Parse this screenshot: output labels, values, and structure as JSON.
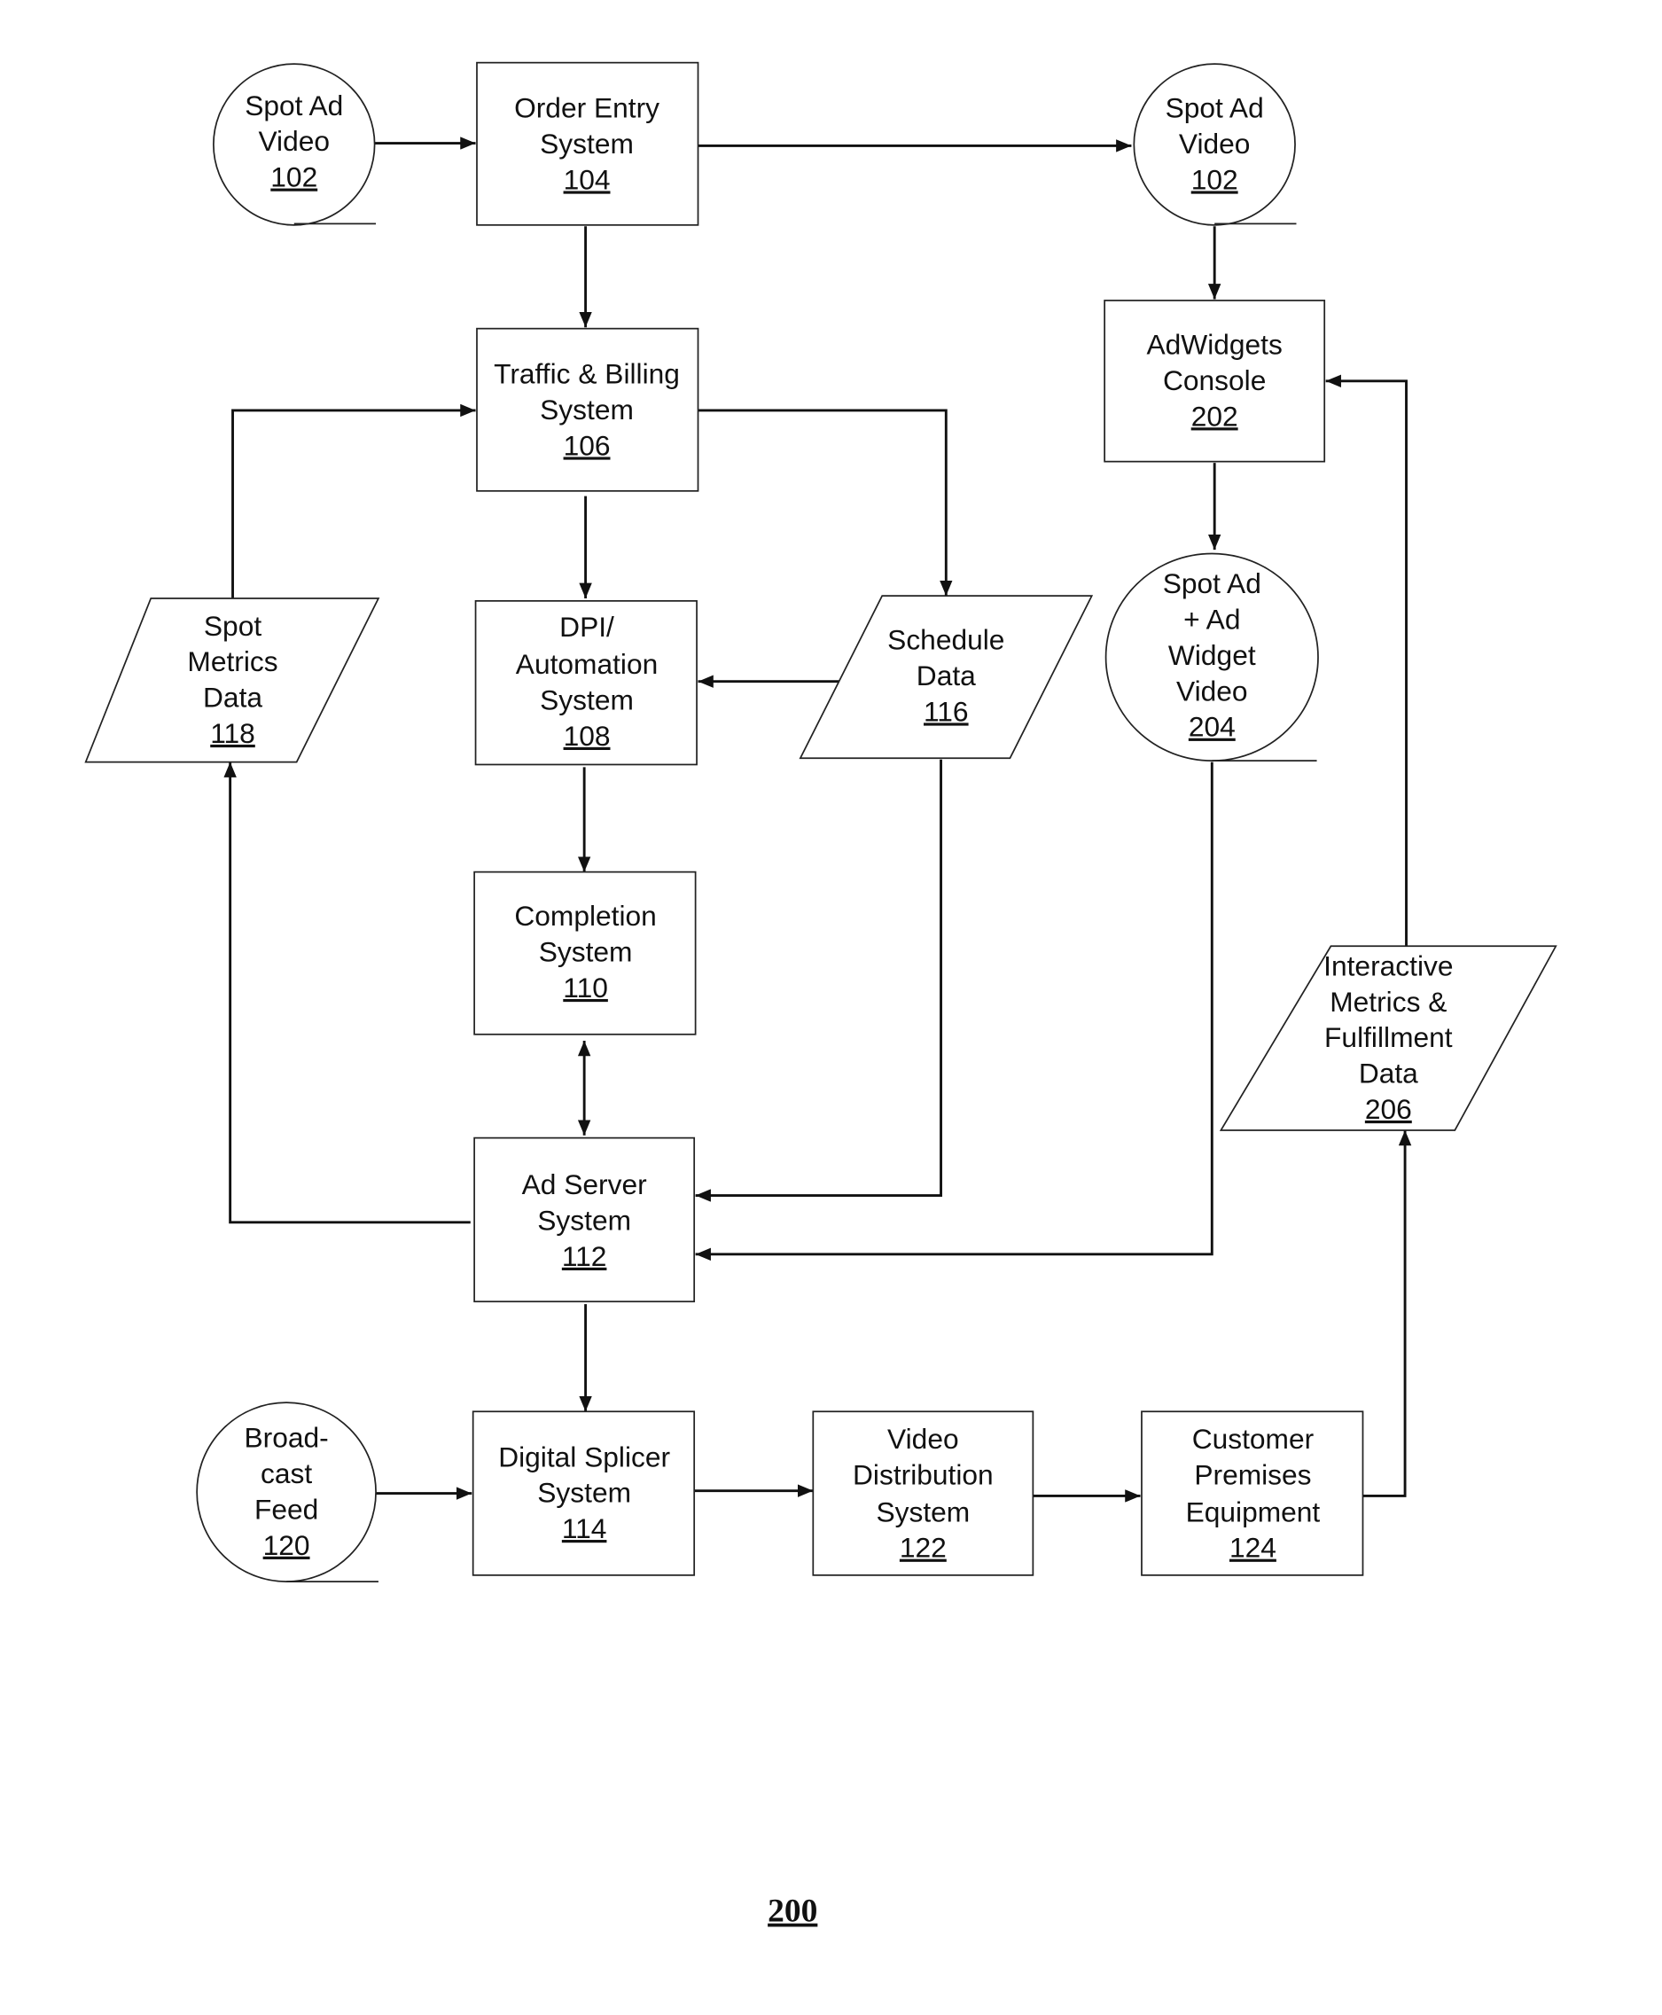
{
  "figure_number": "200",
  "nodes": {
    "spot_ad_video_in": {
      "lines": [
        "Spot Ad",
        "Video"
      ],
      "ref": "102",
      "shape": "circle"
    },
    "order_entry": {
      "lines": [
        "Order Entry",
        "System"
      ],
      "ref": "104",
      "shape": "box"
    },
    "spot_ad_video_out": {
      "lines": [
        "Spot Ad",
        "Video"
      ],
      "ref": "102",
      "shape": "circle"
    },
    "traffic_billing": {
      "lines": [
        "Traffic & Billing",
        "System"
      ],
      "ref": "106",
      "shape": "box"
    },
    "adwidgets_console": {
      "lines": [
        "AdWidgets",
        "Console"
      ],
      "ref": "202",
      "shape": "box"
    },
    "spot_metrics": {
      "lines": [
        "Spot",
        "Metrics",
        "Data"
      ],
      "ref": "118",
      "shape": "parallelogram"
    },
    "dpi_automation": {
      "lines": [
        "DPI/",
        "Automation",
        "System"
      ],
      "ref": "108",
      "shape": "box"
    },
    "schedule_data": {
      "lines": [
        "Schedule",
        "Data"
      ],
      "ref": "116",
      "shape": "parallelogram"
    },
    "spot_ad_widget_video": {
      "lines": [
        "Spot Ad",
        "+ Ad",
        "Widget",
        "Video"
      ],
      "ref": "204",
      "shape": "circle"
    },
    "completion": {
      "lines": [
        "Completion",
        "System"
      ],
      "ref": "110",
      "shape": "box"
    },
    "interactive_metrics": {
      "lines": [
        "Interactive",
        "Metrics &",
        "Fulfillment",
        "Data"
      ],
      "ref": "206",
      "shape": "parallelogram"
    },
    "ad_server": {
      "lines": [
        "Ad Server",
        "System"
      ],
      "ref": "112",
      "shape": "box"
    },
    "broadcast_feed": {
      "lines": [
        "Broad-",
        "cast",
        "Feed"
      ],
      "ref": "120",
      "shape": "circle"
    },
    "digital_splicer": {
      "lines": [
        "Digital Splicer",
        "System"
      ],
      "ref": "114",
      "shape": "box"
    },
    "video_distribution": {
      "lines": [
        "Video",
        "Distribution",
        "System"
      ],
      "ref": "122",
      "shape": "box"
    },
    "customer_premises": {
      "lines": [
        "Customer",
        "Premises",
        "Equipment"
      ],
      "ref": "124",
      "shape": "box"
    }
  },
  "edges": [
    {
      "from": "spot_ad_video_in",
      "to": "order_entry"
    },
    {
      "from": "order_entry",
      "to": "spot_ad_video_out"
    },
    {
      "from": "order_entry",
      "to": "traffic_billing"
    },
    {
      "from": "spot_ad_video_out",
      "to": "adwidgets_console"
    },
    {
      "from": "traffic_billing",
      "to": "dpi_automation"
    },
    {
      "from": "traffic_billing",
      "to": "schedule_data"
    },
    {
      "from": "spot_metrics",
      "to": "traffic_billing"
    },
    {
      "from": "schedule_data",
      "to": "dpi_automation"
    },
    {
      "from": "adwidgets_console",
      "to": "spot_ad_widget_video"
    },
    {
      "from": "dpi_automation",
      "to": "completion"
    },
    {
      "from": "completion",
      "to": "ad_server",
      "bidirectional": true
    },
    {
      "from": "schedule_data",
      "to": "ad_server"
    },
    {
      "from": "spot_ad_widget_video",
      "to": "ad_server"
    },
    {
      "from": "ad_server",
      "to": "spot_metrics"
    },
    {
      "from": "ad_server",
      "to": "digital_splicer"
    },
    {
      "from": "broadcast_feed",
      "to": "digital_splicer"
    },
    {
      "from": "digital_splicer",
      "to": "video_distribution"
    },
    {
      "from": "video_distribution",
      "to": "customer_premises"
    },
    {
      "from": "customer_premises",
      "to": "interactive_metrics"
    },
    {
      "from": "interactive_metrics",
      "to": "adwidgets_console"
    }
  ]
}
